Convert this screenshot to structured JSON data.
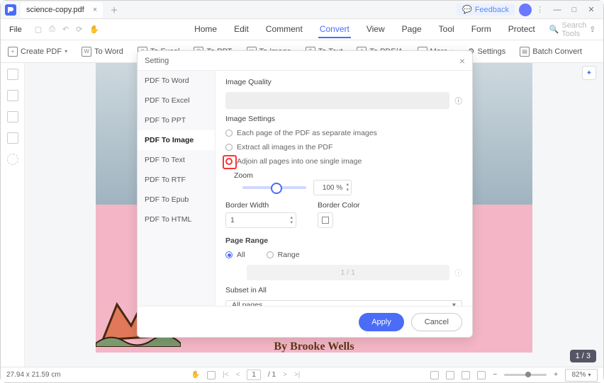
{
  "titlebar": {
    "tab_name": "science-copy.pdf",
    "feedback": "Feedback"
  },
  "menubar": {
    "file": "File",
    "items": [
      "Home",
      "Edit",
      "Comment",
      "Convert",
      "View",
      "Page",
      "Tool",
      "Form",
      "Protect"
    ],
    "active_index": 3,
    "search_placeholder": "Search Tools"
  },
  "toolbar": {
    "create_pdf": "Create PDF",
    "to_word": "To Word",
    "to_excel": "To Excel",
    "to_ppt": "To PPT",
    "to_image": "To Image",
    "to_text": "To Text",
    "to_pdfa": "To PDF/A",
    "more": "More",
    "settings": "Settings",
    "batch": "Batch Convert"
  },
  "canvas": {
    "page_indicator": "1 / 3",
    "doc_byline": "By Brooke Wells"
  },
  "dialog": {
    "title": "Setting",
    "side_items": [
      "PDF To Word",
      "PDF To Excel",
      "PDF To PPT",
      "PDF To Image",
      "PDF To Text",
      "PDF To RTF",
      "PDF To Epub",
      "PDF To HTML"
    ],
    "selected_index": 3,
    "image_quality_label": "Image Quality",
    "image_settings_label": "Image Settings",
    "opt_each_page": "Each page of the PDF as separate images",
    "opt_extract": "Extract all images in the PDF",
    "opt_adjoin": "Adjoin all pages into one single image",
    "zoom_label": "Zoom",
    "zoom_value": "100 %",
    "border_width_label": "Border Width",
    "border_width_value": "1",
    "border_color_label": "Border Color",
    "page_range_label": "Page Range",
    "range_all": "All",
    "range_range": "Range",
    "range_box": "1 / 1",
    "subset_label": "Subset in All",
    "subset_value": "All pages",
    "apply": "Apply",
    "cancel": "Cancel"
  },
  "status": {
    "dimensions": "27.94 x 21.59 cm",
    "page_current": "1",
    "page_total": "/ 1",
    "zoom_pct": "82%"
  }
}
